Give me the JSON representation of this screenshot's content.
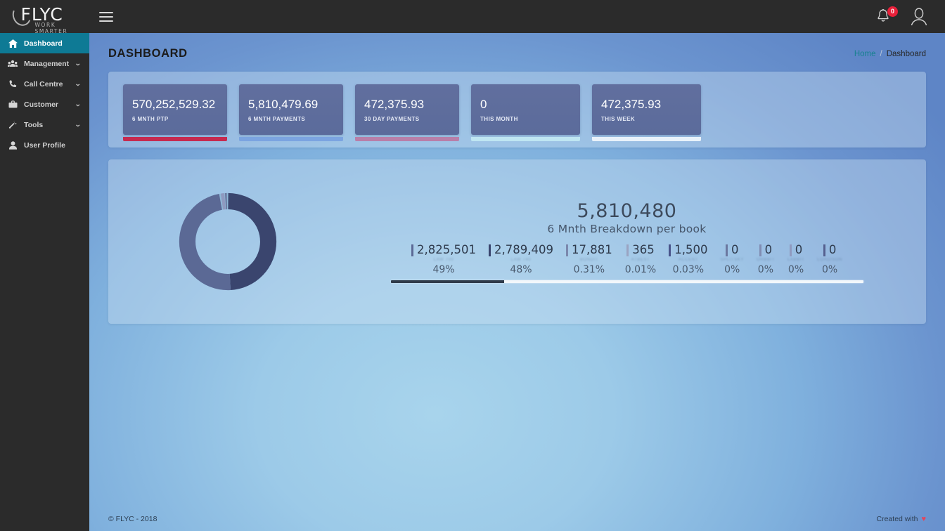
{
  "brand": {
    "name": "FLYC",
    "tagline": "WORK SMARTER",
    "accent_teal": "#0e7a95",
    "sidebar_bg": "#2b2b2b"
  },
  "topbar": {
    "menu_icon": "hamburger-icon",
    "notifications": {
      "icon": "bell-icon",
      "count": "0",
      "badge_color": "#e8203a"
    },
    "profile": {
      "icon": "user-avatar-icon"
    }
  },
  "sidebar": {
    "items": [
      {
        "label": "Dashboard",
        "icon": "home-icon",
        "active": true,
        "expandable": false
      },
      {
        "label": "Management",
        "icon": "users-icon",
        "active": false,
        "expandable": true
      },
      {
        "label": "Call Centre",
        "icon": "phone-icon",
        "active": false,
        "expandable": true
      },
      {
        "label": "Customer",
        "icon": "briefcase-icon",
        "active": false,
        "expandable": true
      },
      {
        "label": "Tools",
        "icon": "tools-icon",
        "active": false,
        "expandable": true
      },
      {
        "label": "User Profile",
        "icon": "person-icon",
        "active": false,
        "expandable": false
      }
    ],
    "chevron": "⌄"
  },
  "header": {
    "title": "DASHBOARD",
    "breadcrumb": {
      "home": "Home",
      "separator": "/",
      "current": "Dashboard"
    }
  },
  "stats": [
    {
      "value": "570,252,529.32",
      "label": "6 MNTH PTP",
      "bar_color": "#c62a4f"
    },
    {
      "value": "5,810,479.69",
      "label": "6 MNTH PAYMENTS",
      "bar_color": "#7ba4e0"
    },
    {
      "value": "472,375.93",
      "label": "30 DAY PAYMENTS",
      "bar_color": "#b87fa8"
    },
    {
      "value": "0",
      "label": "THIS MONTH",
      "bar_color": "#bfe6f2"
    },
    {
      "value": "472,375.93",
      "label": "THIS WEEK",
      "bar_color": "#e9f2fa"
    }
  ],
  "chart_data": {
    "type": "pie",
    "title": "6 Mnth Breakdown per book",
    "total_label": "5,810,480",
    "total_value": 5810480,
    "categories": [
      "Law 700",
      "Law 740",
      "Bondit",
      "Atbest",
      "Accent",
      "Splitsky",
      "Orbbit",
      "Labbit",
      "Loadison"
    ],
    "segments": [
      {
        "name": "Law 700",
        "value": 2825501,
        "value_label": "2,825,501",
        "percent_label": "49%",
        "percent": 49,
        "color": "#5b6995"
      },
      {
        "name": "Law 740",
        "value": 2789409,
        "value_label": "2,789,409",
        "percent_label": "48%",
        "percent": 48,
        "color": "#3a456e"
      },
      {
        "name": "Bondit",
        "value": 17881,
        "value_label": "17,881",
        "percent_label": "0.31%",
        "percent": 0.31,
        "color": "#7b88ad"
      },
      {
        "name": "Atbest",
        "value": 365,
        "value_label": "365",
        "percent_label": "0.01%",
        "percent": 0.01,
        "color": "#9aa4c2"
      },
      {
        "name": "Accent",
        "value": 1500,
        "value_label": "1,500",
        "percent_label": "0.03%",
        "percent": 0.03,
        "color": "#49548a"
      },
      {
        "name": "Splitsky",
        "value": 0,
        "value_label": "0",
        "percent_label": "0%",
        "percent": 0,
        "color": "#6b78a0"
      },
      {
        "name": "Orbbit",
        "value": 0,
        "value_label": "0",
        "percent_label": "0%",
        "percent": 0,
        "color": "#808cb2"
      },
      {
        "name": "Labbit",
        "value": 0,
        "value_label": "0",
        "percent_label": "0%",
        "percent": 0,
        "color": "#8f9ac0"
      },
      {
        "name": "Loadison",
        "value": 0,
        "value_label": "0",
        "percent_label": "0%",
        "percent": 0,
        "color": "#55608f"
      }
    ],
    "progress_percent": 24,
    "legend_position": "inline-below-values",
    "grid": false
  },
  "footer": {
    "copyright": "© FLYC - 2018",
    "created_with": "Created with",
    "heart": "♥"
  }
}
